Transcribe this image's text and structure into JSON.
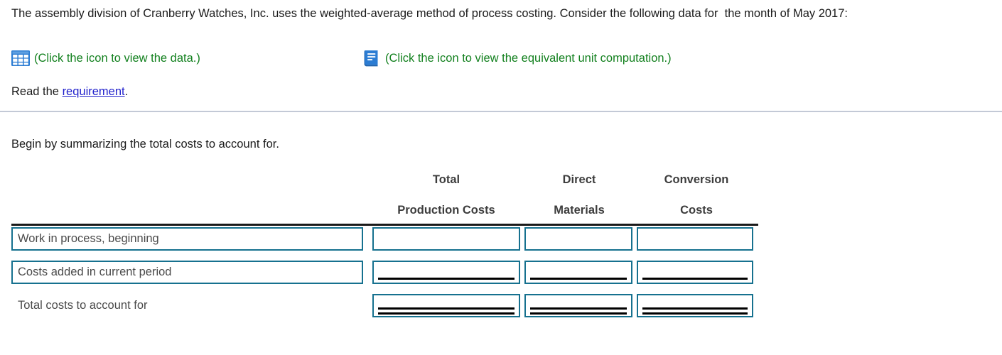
{
  "problem": {
    "statement": "The assembly division of Cranberry Watches, Inc. uses the weighted-average method of process costing. Consider the following data for  the month of May 2017:",
    "icon_links": [
      {
        "icon": "spreadsheet-grid-icon",
        "label": "(Click the icon to view the data.)"
      },
      {
        "icon": "book-icon",
        "label": "(Click the icon to view the equivalent unit computation.)"
      }
    ],
    "read_prefix": "Read the ",
    "read_link": "requirement",
    "read_suffix": "."
  },
  "instruction": "Begin by summarizing the total costs to account for.",
  "table": {
    "headers": [
      {
        "line1": "Total",
        "line2": "Production Costs"
      },
      {
        "line1": "Direct",
        "line2": "Materials"
      },
      {
        "line1": "Conversion",
        "line2": "Costs"
      }
    ],
    "rows": [
      {
        "label": "Work in process, beginning",
        "label_boxed": true,
        "underline": "none",
        "values": [
          "",
          "",
          ""
        ]
      },
      {
        "label": "Costs added in current period",
        "label_boxed": true,
        "underline": "single",
        "values": [
          "",
          "",
          ""
        ]
      },
      {
        "label": "Total costs to account for",
        "label_boxed": false,
        "underline": "double",
        "values": [
          "",
          "",
          ""
        ]
      }
    ]
  },
  "colors": {
    "link": "#2222CC",
    "icon_label_green": "#12801E",
    "field_border_teal": "#16718F",
    "icon_blue": "#2B7CD3",
    "header_text": "#3D3D3D",
    "divider": "#C3C9D6"
  }
}
